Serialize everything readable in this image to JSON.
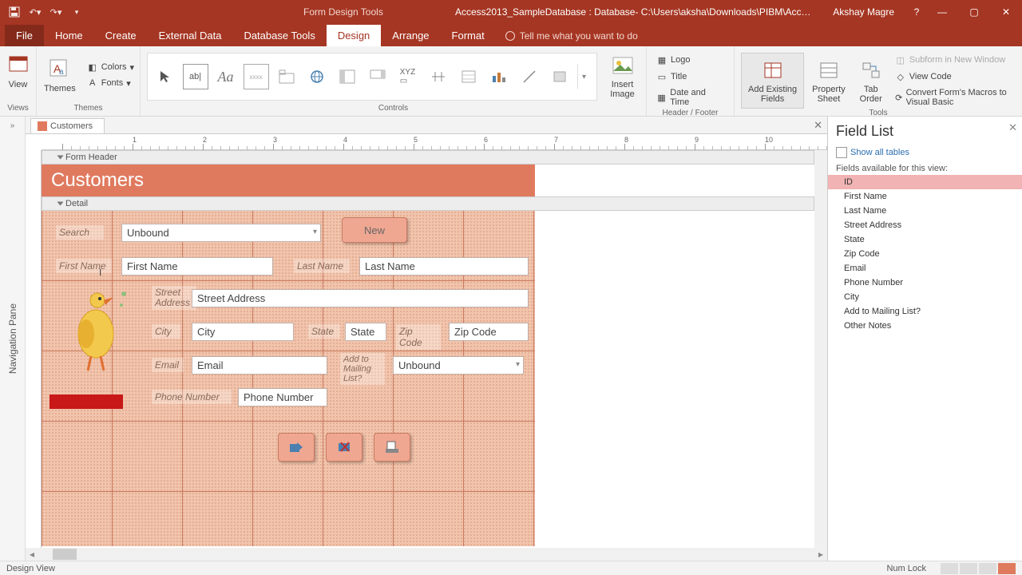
{
  "titlebar": {
    "form_tools": "Form Design Tools",
    "db_title": "Access2013_SampleDatabase : Database- C:\\Users\\aksha\\Downloads\\PIBM\\Access2013_...",
    "username": "Akshay Magre",
    "help": "?"
  },
  "tabs": {
    "file": "File",
    "home": "Home",
    "create": "Create",
    "external": "External Data",
    "dbtools": "Database Tools",
    "design": "Design",
    "arrange": "Arrange",
    "format": "Format",
    "tellme": "Tell me what you want to do"
  },
  "ribbon": {
    "views": {
      "label": "Views",
      "view": "View"
    },
    "themes": {
      "label": "Themes",
      "themes": "Themes",
      "colors": "Colors",
      "fonts": "Fonts"
    },
    "controls": {
      "label": "Controls",
      "insert_image": "Insert\nImage"
    },
    "headerfooter": {
      "label": "Header / Footer",
      "logo": "Logo",
      "title": "Title",
      "datetime": "Date and Time"
    },
    "tools": {
      "label": "Tools",
      "add_existing": "Add Existing\nFields",
      "property": "Property\nSheet",
      "tab_order": "Tab\nOrder",
      "subform": "Subform in New Window",
      "viewcode": "View Code",
      "convert": "Convert Form's Macros to Visual Basic"
    }
  },
  "navpane": {
    "label": "Navigation Pane"
  },
  "doc": {
    "tabname": "Customers"
  },
  "sections": {
    "formheader": "Form Header",
    "detail": "Detail"
  },
  "form": {
    "title": "Customers",
    "search_lbl": "Search",
    "search_val": "Unbound",
    "new_btn": "New",
    "fname_lbl": "First Name",
    "fname_val": "First Name",
    "lname_lbl": "Last Name",
    "lname_val": "Last Name",
    "street_lbl": "Street Address",
    "street_val": "Street Address",
    "city_lbl": "City",
    "city_val": "City",
    "state_lbl": "State",
    "state_val": "State",
    "zip_lbl": "Zip Code",
    "zip_val": "Zip Code",
    "email_lbl": "Email",
    "email_val": "Email",
    "addto_lbl": "Add to Mailing List?",
    "addto_val": "Unbound",
    "phone_lbl": "Phone Number",
    "phone_val": "Phone Number"
  },
  "fieldlist": {
    "title": "Field List",
    "showall": "Show all tables",
    "available": "Fields available for this view:",
    "fields": [
      "ID",
      "First Name",
      "Last Name",
      "Street Address",
      "State",
      "Zip Code",
      "Email",
      "Phone Number",
      "City",
      "Add to Mailing List?",
      "Other Notes"
    ]
  },
  "statusbar": {
    "left": "Design View",
    "numlock": "Num Lock"
  },
  "ruler_marks": [
    "1",
    "2",
    "3",
    "4",
    "5",
    "6",
    "7",
    "8",
    "9",
    "10"
  ]
}
